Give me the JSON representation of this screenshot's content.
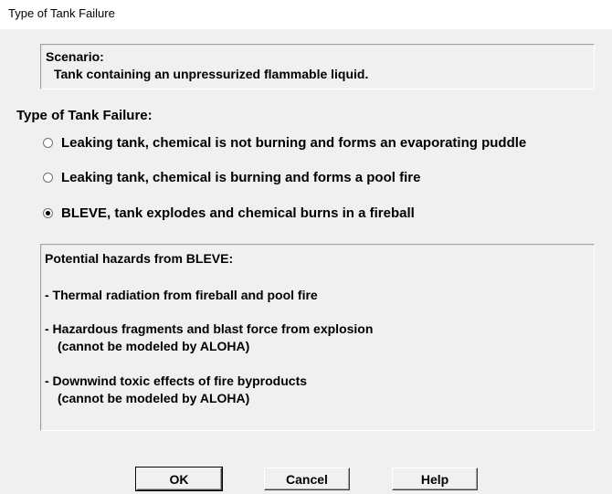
{
  "window": {
    "title": "Type of Tank Failure"
  },
  "scenario": {
    "heading": "Scenario:",
    "text": "Tank containing an unpressurized flammable liquid."
  },
  "failure_type": {
    "label": "Type of Tank Failure:",
    "options": [
      {
        "label": "Leaking tank, chemical is not burning and forms an evaporating puddle",
        "selected": false
      },
      {
        "label": "Leaking tank, chemical is burning and forms a pool fire",
        "selected": false
      },
      {
        "label": "BLEVE, tank explodes and chemical burns in a fireball",
        "selected": true
      }
    ]
  },
  "hazards": {
    "heading": "Potential hazards from BLEVE:",
    "item1": "- Thermal radiation from fireball and pool fire",
    "item2_line1": "- Hazardous fragments and blast force from explosion",
    "item2_line2": "(cannot be modeled by ALOHA)",
    "item3_line1": "- Downwind toxic effects of fire byproducts",
    "item3_line2": "(cannot be modeled by ALOHA)"
  },
  "buttons": {
    "ok": "OK",
    "cancel": "Cancel",
    "help": "Help"
  }
}
